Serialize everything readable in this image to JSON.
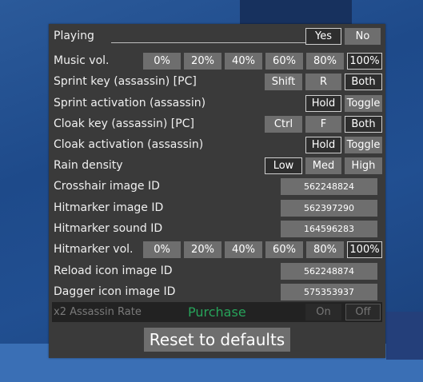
{
  "settings": {
    "playing": {
      "label": "Playing",
      "options": [
        "Yes",
        "No"
      ]
    },
    "music_vol": {
      "label": "Music vol.",
      "options": [
        "0%",
        "20%",
        "40%",
        "60%",
        "80%",
        "100%"
      ]
    },
    "sprint_key": {
      "label": "Sprint key (assassin) [PC]",
      "options": [
        "Shift",
        "R",
        "Both"
      ]
    },
    "sprint_activation": {
      "label": "Sprint activation (assassin)",
      "options": [
        "Hold",
        "Toggle"
      ]
    },
    "cloak_key": {
      "label": "Cloak key (assassin) [PC]",
      "options": [
        "Ctrl",
        "F",
        "Both"
      ]
    },
    "cloak_activation": {
      "label": "Cloak activation (assassin)",
      "options": [
        "Hold",
        "Toggle"
      ]
    },
    "rain_density": {
      "label": "Rain density",
      "options": [
        "Low",
        "Med",
        "High"
      ]
    },
    "crosshair_id": {
      "label": "Crosshair image ID",
      "value": "562248824"
    },
    "hitmarker_id": {
      "label": "Hitmarker image ID",
      "value": "562397290"
    },
    "hitmarker_sound": {
      "label": "Hitmarker sound ID",
      "value": "164596283"
    },
    "hitmarker_vol": {
      "label": "Hitmarker vol.",
      "options": [
        "0%",
        "20%",
        "40%",
        "60%",
        "80%",
        "100%"
      ]
    },
    "reload_icon": {
      "label": "Reload icon image ID",
      "value": "562248874"
    },
    "dagger_icon": {
      "label": "Dagger icon image ID",
      "value": "575353937"
    },
    "assassin_rate": {
      "label": "x2 Assassin Rate",
      "purchase": "Purchase",
      "options": [
        "On",
        "Off"
      ]
    }
  },
  "reset_label": "Reset to defaults",
  "colors": {
    "panel": "#3a3a3a",
    "button": "#6e6e6e",
    "selected": "#2e2e2e",
    "purchase": "#27a35a"
  }
}
